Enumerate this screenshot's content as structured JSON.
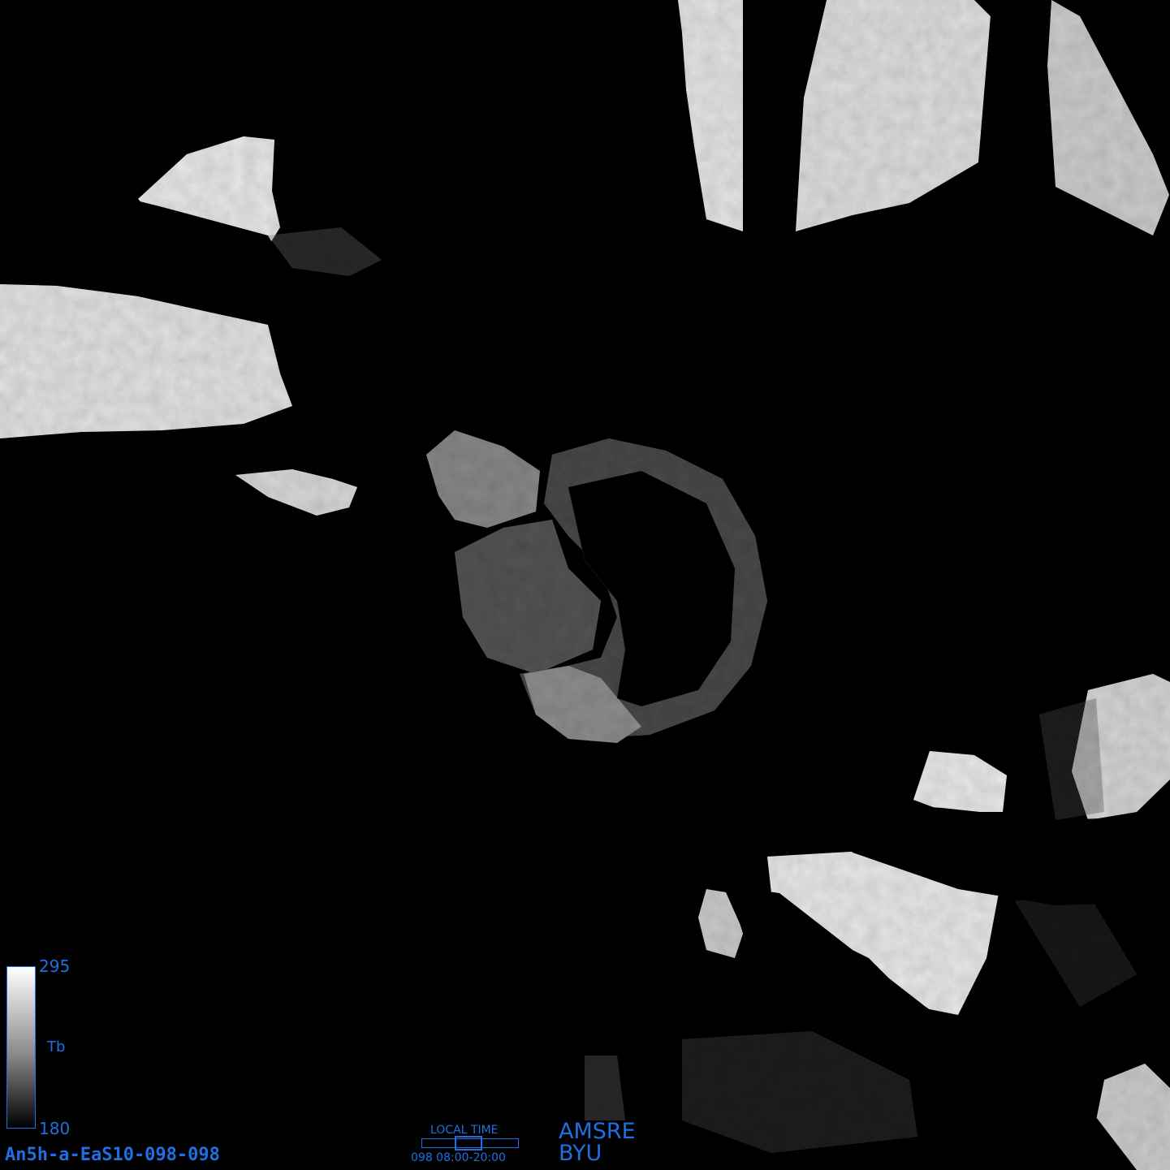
{
  "image": {
    "product_id": "An5h-a-EaS10-098-098",
    "sensor": "AMSRE",
    "organization": "BYU"
  },
  "colorbar": {
    "max": "295",
    "min": "180",
    "unit": "Tb",
    "colormap": "grayscale"
  },
  "local_time": {
    "title": "LOCAL TIME",
    "range": "098  08:00-20:00"
  },
  "colors": {
    "background": "#000000",
    "label": "#1f6fe0"
  }
}
